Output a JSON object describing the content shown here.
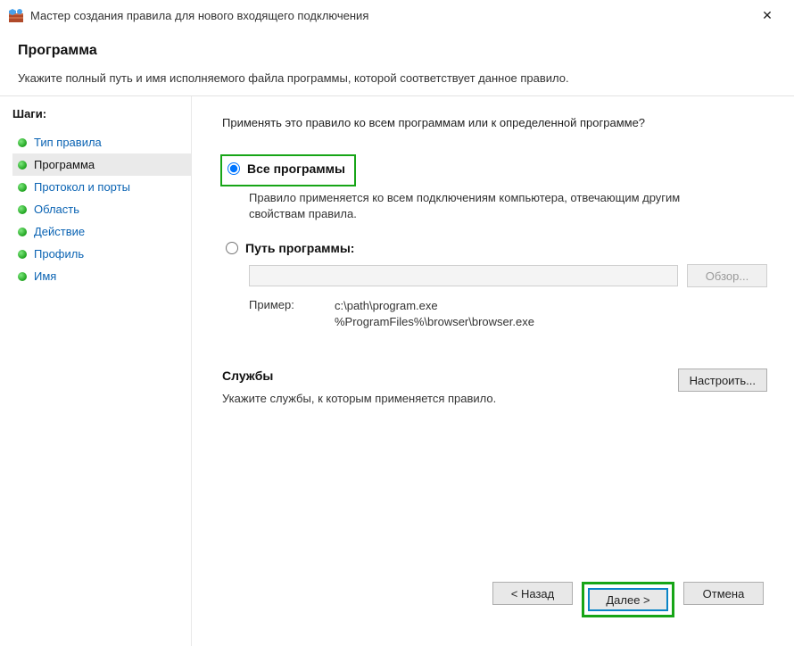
{
  "window": {
    "title": "Мастер создания правила для нового входящего подключения",
    "close_symbol": "✕"
  },
  "header": {
    "page_title": "Программа",
    "page_subtitle": "Укажите полный путь и имя исполняемого файла программы, которой соответствует данное правило."
  },
  "sidebar": {
    "heading": "Шаги:",
    "items": [
      {
        "label": "Тип правила"
      },
      {
        "label": "Программа"
      },
      {
        "label": "Протокол и порты"
      },
      {
        "label": "Область"
      },
      {
        "label": "Действие"
      },
      {
        "label": "Профиль"
      },
      {
        "label": "Имя"
      }
    ],
    "active_index": 1
  },
  "main": {
    "prompt": "Применять это правило ко всем программам или к определенной программе?",
    "option_all": {
      "label": "Все программы",
      "description": "Правило применяется ко всем подключениям компьютера, отвечающим другим свойствам правила."
    },
    "option_path": {
      "label": "Путь программы:",
      "input_value": "",
      "browse_label": "Обзор..."
    },
    "example": {
      "label": "Пример:",
      "line1": "c:\\path\\program.exe",
      "line2": "%ProgramFiles%\\browser\\browser.exe"
    },
    "services": {
      "heading": "Службы",
      "description": "Укажите службы, к которым применяется правило.",
      "configure_label": "Настроить..."
    }
  },
  "footer": {
    "back_label": "< Назад",
    "next_label": "Далее >",
    "cancel_label": "Отмена"
  }
}
